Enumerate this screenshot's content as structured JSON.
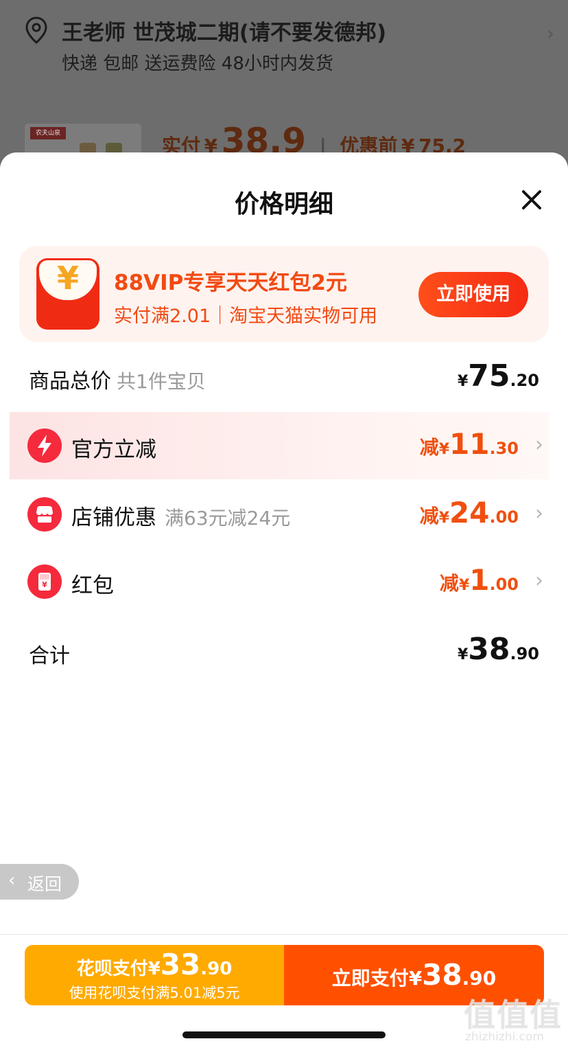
{
  "background": {
    "address_title": "王老师 世茂城二期(请不要发德邦)",
    "address_subtitle": "快递 包邮 送运费险 48小时内发货",
    "product_tag": "农夫山泉",
    "paid_label": "实付",
    "paid_currency": "¥",
    "paid_value": "38.9",
    "original_label": "优惠前",
    "original_currency": "¥",
    "original_value": "75.2"
  },
  "sheet": {
    "title": "价格明细",
    "promo": {
      "title": "88VIP专享天天红包2元",
      "subtitle": "实付满2.01｜淘宝天猫实物可用",
      "button": "立即使用",
      "envelope_symbol": "¥"
    },
    "subtotal": {
      "label": "商品总价",
      "note": "共1件宝贝",
      "currency": "¥",
      "int": "75",
      "dec": ".20"
    },
    "items": [
      {
        "label": "官方立减",
        "note": "",
        "prefix": "减",
        "currency": "¥",
        "int": "11",
        "dec": ".30",
        "icon": "lightning-icon"
      },
      {
        "label": "店铺优惠",
        "note": "满63元减24元",
        "prefix": "减",
        "currency": "¥",
        "int": "24",
        "dec": ".00",
        "icon": "store-icon"
      },
      {
        "label": "红包",
        "note": "",
        "prefix": "减",
        "currency": "¥",
        "int": "1",
        "dec": ".00",
        "icon": "red-packet-icon"
      }
    ],
    "total": {
      "label": "合计",
      "currency": "¥",
      "int": "38",
      "dec": ".90"
    },
    "back": "返回",
    "huabei": {
      "label": "花呗支付",
      "currency": "¥",
      "int": "33",
      "dec": ".90",
      "subtitle": "使用花呗支付满5.01减5元"
    },
    "pay_now": {
      "label": "立即支付",
      "currency": "¥",
      "int": "38",
      "dec": ".90"
    }
  },
  "watermark": {
    "mark": "值值值",
    "site": "zhizhizhi.com"
  },
  "colors": {
    "accent": "#ff5000",
    "discount": "#f04f0f",
    "huabei": "#ffaa00",
    "icon_red": "#f52a3d"
  }
}
